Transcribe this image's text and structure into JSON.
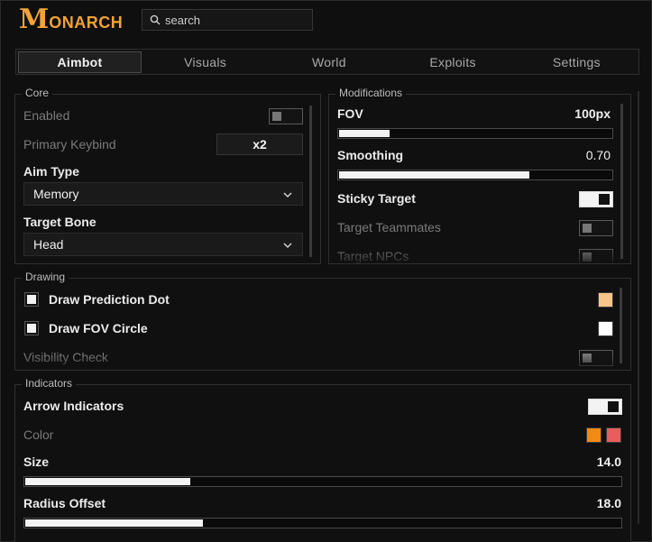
{
  "app": {
    "logo_initial": "M",
    "logo_rest": "ONARCH"
  },
  "search": {
    "placeholder": "search"
  },
  "tabs": [
    {
      "label": "Aimbot",
      "active": true
    },
    {
      "label": "Visuals"
    },
    {
      "label": "World"
    },
    {
      "label": "Exploits"
    },
    {
      "label": "Settings"
    }
  ],
  "core": {
    "title": "Core",
    "enabled_label": "Enabled",
    "enabled": false,
    "keybind_label": "Primary Keybind",
    "keybind_value": "x2",
    "aim_type_label": "Aim Type",
    "aim_type_value": "Memory",
    "target_bone_label": "Target Bone",
    "target_bone_value": "Head"
  },
  "modifications": {
    "title": "Modifications",
    "fov_label": "FOV",
    "fov_value": "100px",
    "fov_fill": 0.19,
    "smoothing_label": "Smoothing",
    "smoothing_value": "0.70",
    "smoothing_fill": 0.7,
    "sticky_label": "Sticky Target",
    "sticky": true,
    "teammates_label": "Target Teammates",
    "teammates": false,
    "npcs_label": "Target NPCs",
    "npcs": false
  },
  "drawing": {
    "title": "Drawing",
    "prediction_label": "Draw Prediction Dot",
    "prediction_color": "#f7c48a",
    "fov_circle_label": "Draw FOV Circle",
    "fov_circle_color": "#ffffff",
    "visibility_label": "Visibility Check",
    "visibility": false
  },
  "indicators": {
    "title": "Indicators",
    "arrow_label": "Arrow Indicators",
    "arrow": true,
    "color_label": "Color",
    "color_a": "#f08a12",
    "color_b": "#e85e5e",
    "size_label": "Size",
    "size_value": "14.0",
    "size_fill": 0.28,
    "radius_label": "Radius Offset",
    "radius_value": "18.0",
    "radius_fill": 0.3
  },
  "icons": {
    "search": "search-icon",
    "chevron": "chevron-down-icon"
  }
}
